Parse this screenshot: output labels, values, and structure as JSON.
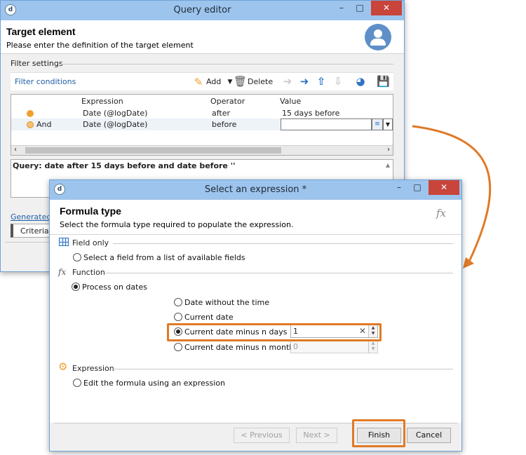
{
  "query_editor": {
    "title": "Query editor",
    "header_title": "Target element",
    "header_subtitle": "Please enter the definition of the target element",
    "filter_settings_label": "Filter settings",
    "filter_conditions_label": "Filter conditions",
    "toolbar": {
      "add_label": "Add",
      "delete_label": "Delete"
    },
    "grid": {
      "columns": [
        "Expression",
        "Operator",
        "Value"
      ],
      "rows": [
        {
          "logic": "",
          "expression": "Date (@logDate)",
          "operator": "after",
          "value": "15 days before"
        },
        {
          "logic": "And",
          "expression": "Date (@logDate)",
          "operator": "before",
          "value": ""
        }
      ]
    },
    "query_text": "Query: date after 15 days before and date before ''",
    "generated_link": "Generated",
    "criteria_tab": "Criteria"
  },
  "select_expression": {
    "title": "Select an expression *",
    "header_title": "Formula type",
    "header_subtitle": "Select the formula type required to populate the expression.",
    "fx_glyph": "fx",
    "sections": {
      "field_only": {
        "label": "Field only",
        "option": "Select a field from a list of available fields"
      },
      "function": {
        "label": "Function",
        "option": "Process on dates",
        "sub_options": [
          {
            "label": "Date without the time",
            "selected": false
          },
          {
            "label": "Current date",
            "selected": false
          },
          {
            "label": "Current date minus n days",
            "selected": true,
            "value": "1"
          },
          {
            "label": "Current date minus n months",
            "selected": false,
            "value": "0"
          }
        ]
      },
      "expression": {
        "label": "Expression",
        "option": "Edit the formula using an expression"
      }
    },
    "buttons": {
      "previous": "< Previous",
      "next": "Next >",
      "finish": "Finish",
      "cancel": "Cancel"
    }
  },
  "colors": {
    "highlight": "#e07a27",
    "titlebar": "#9dc4ec",
    "close": "#c9443a",
    "link": "#1f5fa8"
  }
}
